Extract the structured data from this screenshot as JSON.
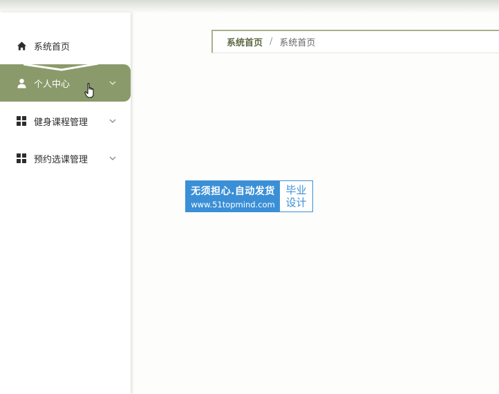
{
  "sidebar": {
    "items": [
      {
        "label": "系统首页",
        "icon": "home-icon"
      },
      {
        "label": "个人中心",
        "icon": "user-icon",
        "active": true
      },
      {
        "label": "健身课程管理",
        "icon": "grid-icon"
      },
      {
        "label": "预约选课管理",
        "icon": "grid-icon"
      }
    ]
  },
  "breadcrumb": {
    "home": "系统首页",
    "separator": "/",
    "current": "系统首页"
  },
  "watermark": {
    "line1": "无须担心.自动发货",
    "line2": "www.51topmind.com",
    "right1": "毕业",
    "right2": "设计"
  },
  "colors": {
    "accent": "#8b9a6b",
    "breadcrumb_border": "#a8b08c",
    "watermark_blue": "#3b8fd6"
  }
}
